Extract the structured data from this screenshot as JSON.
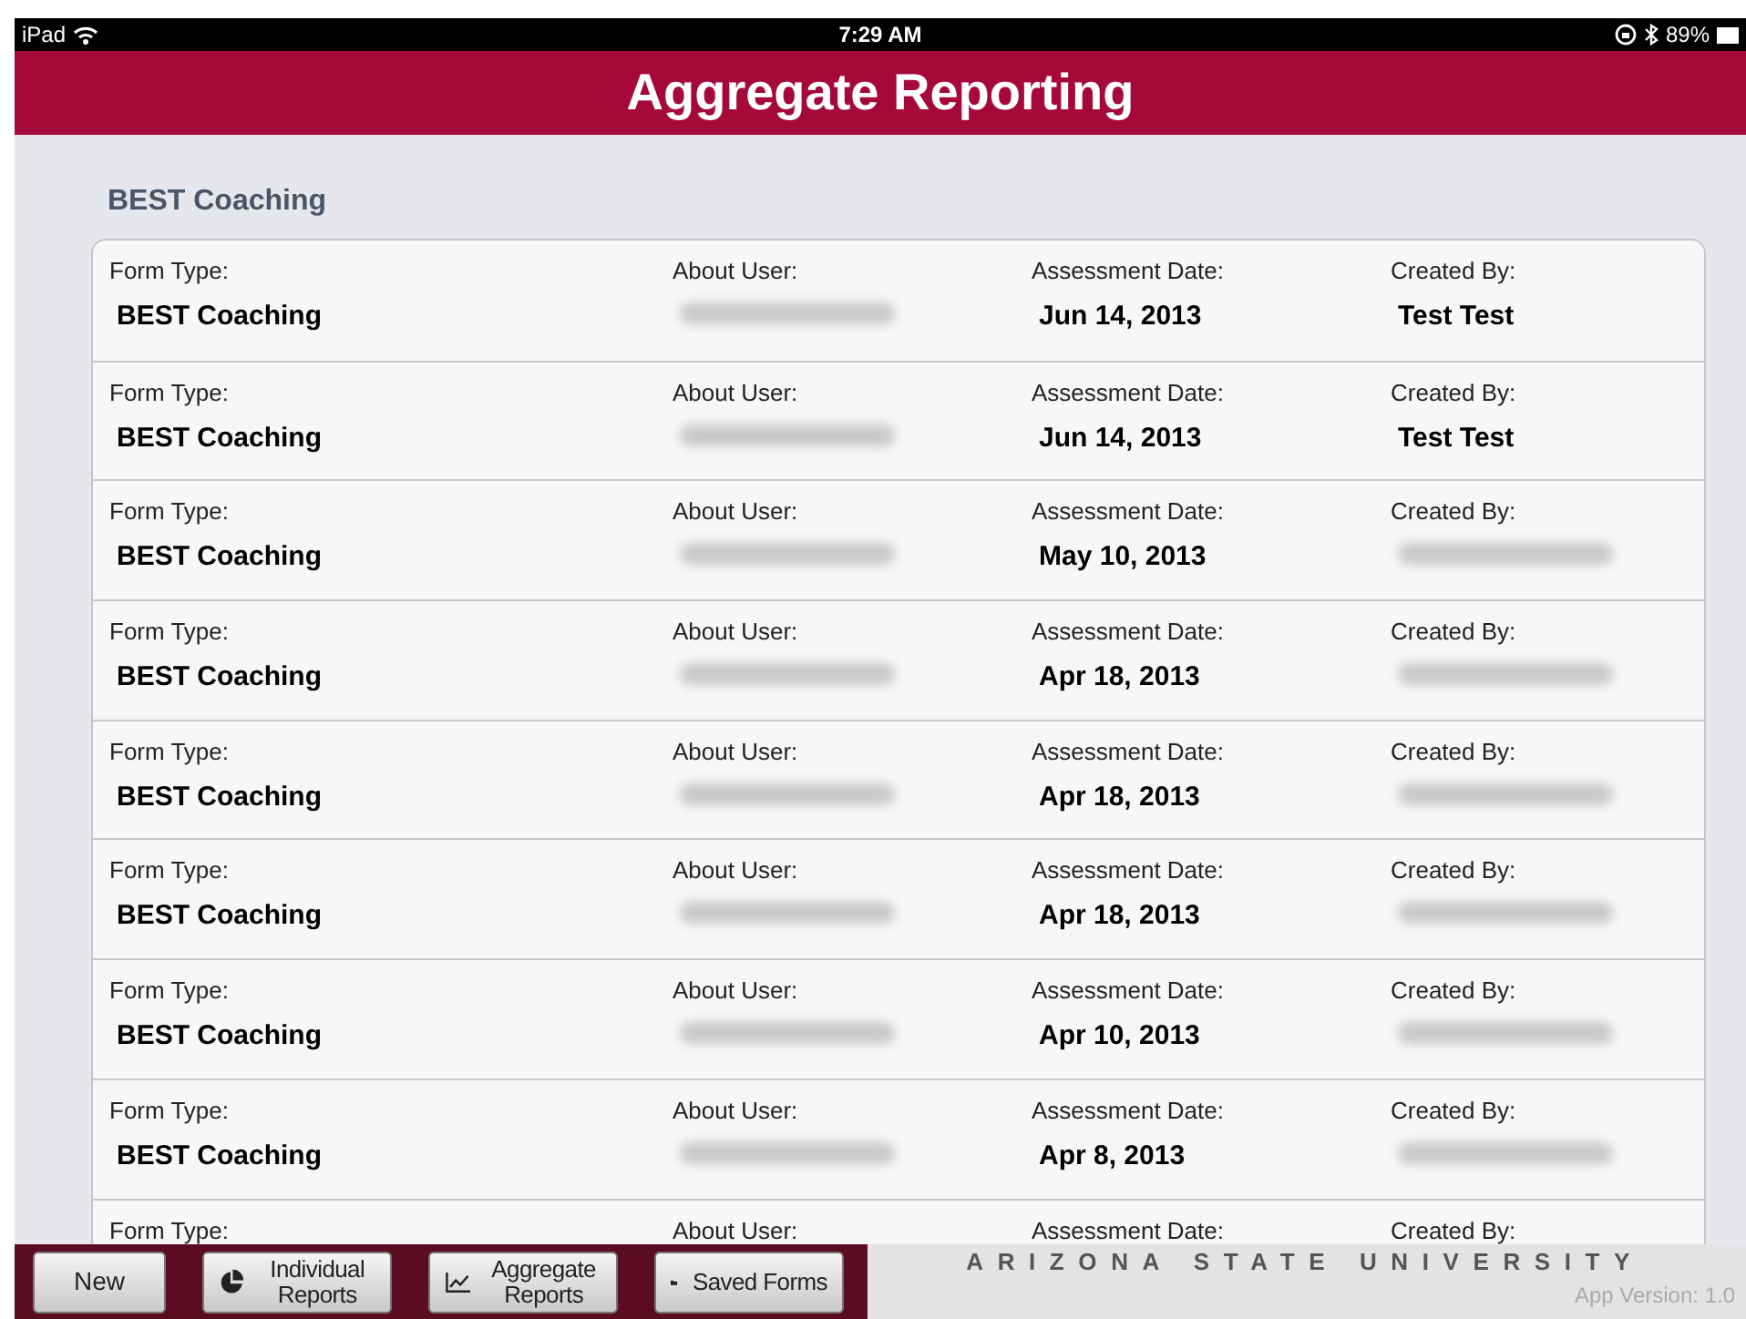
{
  "status_bar": {
    "device": "iPad",
    "time": "7:29 AM",
    "battery": "89%"
  },
  "header": {
    "title": "Aggregate Reporting"
  },
  "section": {
    "title": "BEST Coaching"
  },
  "rows": [
    {
      "cells": [
        {
          "label": "Form Type:",
          "value": {
            "kind": "text",
            "text": "BEST Coaching"
          }
        },
        {
          "label": "About User:",
          "value": {
            "kind": "blurred"
          }
        },
        {
          "label": "Assessment Date:",
          "value": {
            "kind": "text",
            "text": "Jun 14, 2013"
          }
        },
        {
          "label": "Created By:",
          "value": {
            "kind": "text",
            "text": "Test Test"
          }
        }
      ]
    },
    {
      "cells": [
        {
          "label": "Form Type:",
          "value": {
            "kind": "text",
            "text": "BEST Coaching"
          }
        },
        {
          "label": "About User:",
          "value": {
            "kind": "blurred"
          }
        },
        {
          "label": "Assessment Date:",
          "value": {
            "kind": "text",
            "text": "Jun 14, 2013"
          }
        },
        {
          "label": "Created By:",
          "value": {
            "kind": "text",
            "text": "Test Test"
          }
        }
      ]
    },
    {
      "cells": [
        {
          "label": "Form Type:",
          "value": {
            "kind": "text",
            "text": "BEST Coaching"
          }
        },
        {
          "label": "About User:",
          "value": {
            "kind": "blurred"
          }
        },
        {
          "label": "Assessment Date:",
          "value": {
            "kind": "text",
            "text": "May 10, 2013"
          }
        },
        {
          "label": "Created By:",
          "value": {
            "kind": "blurred"
          }
        }
      ]
    },
    {
      "cells": [
        {
          "label": "Form Type:",
          "value": {
            "kind": "text",
            "text": "BEST Coaching"
          }
        },
        {
          "label": "About User:",
          "value": {
            "kind": "blurred"
          }
        },
        {
          "label": "Assessment Date:",
          "value": {
            "kind": "text",
            "text": "Apr 18, 2013"
          }
        },
        {
          "label": "Created By:",
          "value": {
            "kind": "blurred"
          }
        }
      ]
    },
    {
      "cells": [
        {
          "label": "Form Type:",
          "value": {
            "kind": "text",
            "text": "BEST Coaching"
          }
        },
        {
          "label": "About User:",
          "value": {
            "kind": "blurred"
          }
        },
        {
          "label": "Assessment Date:",
          "value": {
            "kind": "text",
            "text": "Apr 18, 2013"
          }
        },
        {
          "label": "Created By:",
          "value": {
            "kind": "blurred"
          }
        }
      ]
    },
    {
      "cells": [
        {
          "label": "Form Type:",
          "value": {
            "kind": "text",
            "text": "BEST Coaching"
          }
        },
        {
          "label": "About User:",
          "value": {
            "kind": "blurred"
          }
        },
        {
          "label": "Assessment Date:",
          "value": {
            "kind": "text",
            "text": "Apr 18, 2013"
          }
        },
        {
          "label": "Created By:",
          "value": {
            "kind": "blurred"
          }
        }
      ]
    },
    {
      "cells": [
        {
          "label": "Form Type:",
          "value": {
            "kind": "text",
            "text": "BEST Coaching"
          }
        },
        {
          "label": "About User:",
          "value": {
            "kind": "blurred"
          }
        },
        {
          "label": "Assessment Date:",
          "value": {
            "kind": "text",
            "text": "Apr 10, 2013"
          }
        },
        {
          "label": "Created By:",
          "value": {
            "kind": "blurred"
          }
        }
      ]
    },
    {
      "cells": [
        {
          "label": "Form Type:",
          "value": {
            "kind": "text",
            "text": "BEST Coaching"
          }
        },
        {
          "label": "About User:",
          "value": {
            "kind": "blurred"
          }
        },
        {
          "label": "Assessment Date:",
          "value": {
            "kind": "text",
            "text": "Apr 8, 2013"
          }
        },
        {
          "label": "Created By:",
          "value": {
            "kind": "blurred"
          }
        }
      ]
    },
    {
      "cells": [
        {
          "label": "Form Type:"
        },
        {
          "label": "About User:"
        },
        {
          "label": "Assessment Date:"
        },
        {
          "label": "Created By:"
        }
      ]
    }
  ],
  "toolbar": {
    "buttons": [
      {
        "kind": "plain",
        "label": "New"
      },
      {
        "kind": "pie",
        "label": "Individual Reports"
      },
      {
        "kind": "chart",
        "label": "Aggregate Reports"
      },
      {
        "kind": "folder",
        "label": "Saved Forms"
      }
    ]
  },
  "footer": {
    "university": "ARIZONA STATE UNIVERSITY",
    "version": "App Version: 1.0"
  }
}
